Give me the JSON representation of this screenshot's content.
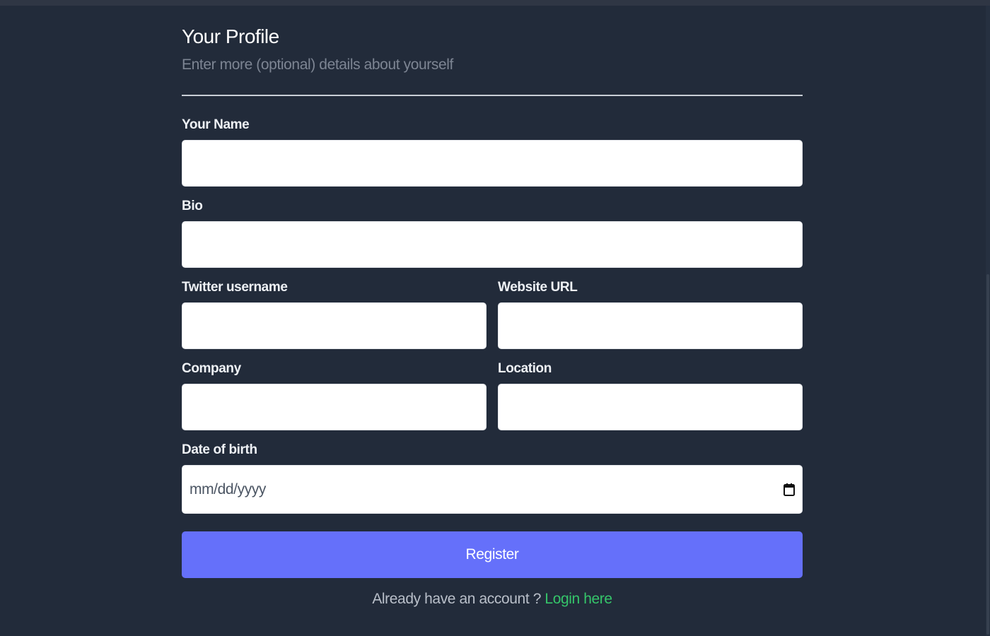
{
  "header": {
    "title": "Your Profile",
    "subtitle": "Enter more (optional) details about yourself"
  },
  "fields": {
    "name": {
      "label": "Your Name",
      "value": ""
    },
    "bio": {
      "label": "Bio",
      "value": ""
    },
    "twitter": {
      "label": "Twitter username",
      "value": ""
    },
    "website": {
      "label": "Website URL",
      "value": ""
    },
    "company": {
      "label": "Company",
      "value": ""
    },
    "location": {
      "label": "Location",
      "value": ""
    },
    "dob": {
      "label": "Date of birth",
      "placeholder": "mm/dd/yyyy",
      "icon": "calendar-icon"
    }
  },
  "actions": {
    "register_label": "Register"
  },
  "footer": {
    "prompt": "Already have an account ?",
    "login_label": "Login here"
  },
  "colors": {
    "background": "#222b3a",
    "accent": "#6570fa",
    "link": "#35c56a"
  }
}
